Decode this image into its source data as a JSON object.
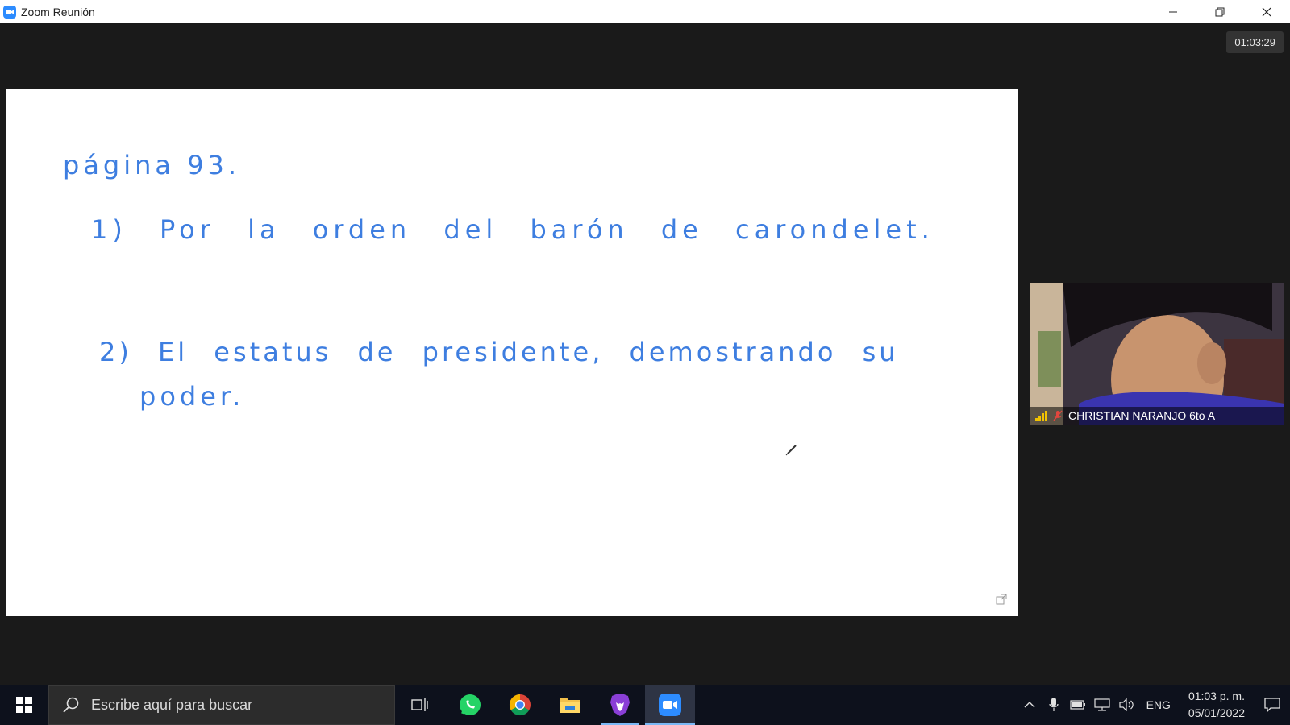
{
  "window": {
    "title": "Zoom Reunión"
  },
  "meeting": {
    "timer": "01:03:29"
  },
  "whiteboard": {
    "line1": "página 93.",
    "line2": "1) Por la orden del barón de carondelet.",
    "line3": "2) El estatus de presidente, demostrando su",
    "line4": "poder.",
    "ink_color": "#3e7ee0"
  },
  "participant": {
    "name": "CHRISTIAN NARANJO 6to A"
  },
  "taskbar": {
    "search_placeholder": "Escribe aquí para buscar",
    "language": "ENG",
    "time": "01:03 p. m.",
    "date": "05/01/2022",
    "apps": [
      "task-view",
      "whatsapp",
      "chrome",
      "file-explorer",
      "brave",
      "zoom"
    ]
  },
  "colors": {
    "zoom_blue": "#2d8cff",
    "meeting_bg": "#1a1a1a",
    "taskbar_bg": "#0d111c"
  }
}
